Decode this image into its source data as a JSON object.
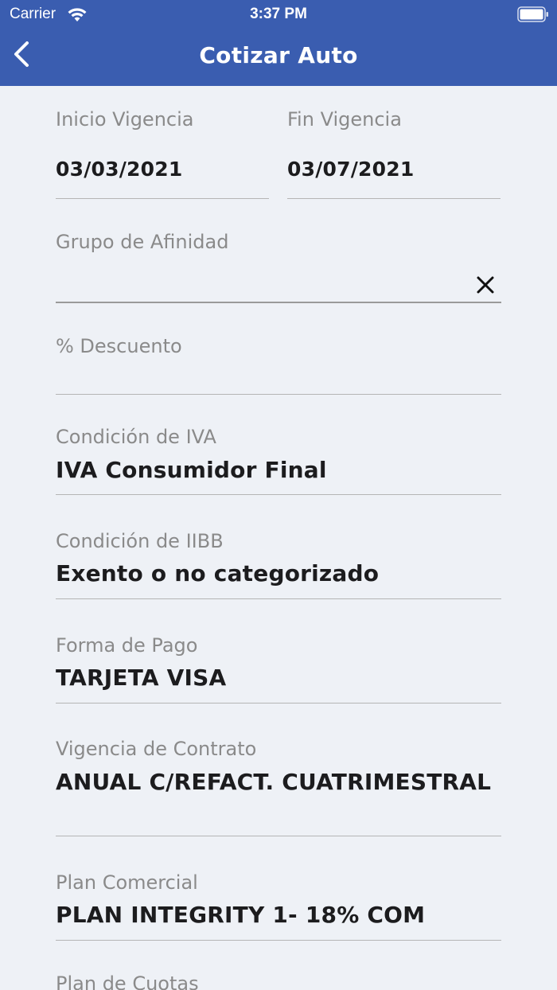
{
  "status_bar": {
    "carrier": "Carrier",
    "time": "3:37 PM"
  },
  "nav": {
    "title": "Cotizar Auto"
  },
  "form": {
    "inicio_vigencia": {
      "label": "Inicio Vigencia",
      "value": "03/03/2021"
    },
    "fin_vigencia": {
      "label": "Fin Vigencia",
      "value": "03/07/2021"
    },
    "grupo_afinidad": {
      "label": "Grupo de Afinidad",
      "value": ""
    },
    "descuento": {
      "label": "% Descuento",
      "value": ""
    },
    "condicion_iva": {
      "label": "Condición de IVA",
      "value": "IVA Consumidor Final"
    },
    "condicion_iibb": {
      "label": "Condición de IIBB",
      "value": "Exento o no categorizado"
    },
    "forma_pago": {
      "label": "Forma de Pago",
      "value": "TARJETA VISA"
    },
    "vigencia_contrato": {
      "label": "Vigencia de Contrato",
      "value": "ANUAL C/REFACT. CUATRIMESTRAL"
    },
    "plan_comercial": {
      "label": "Plan Comercial",
      "value": "PLAN INTEGRITY 1- 18% COM"
    },
    "plan_cuotas": {
      "label": "Plan de Cuotas"
    }
  },
  "colors": {
    "header": "#3a5db0",
    "background": "#eef1f6"
  }
}
